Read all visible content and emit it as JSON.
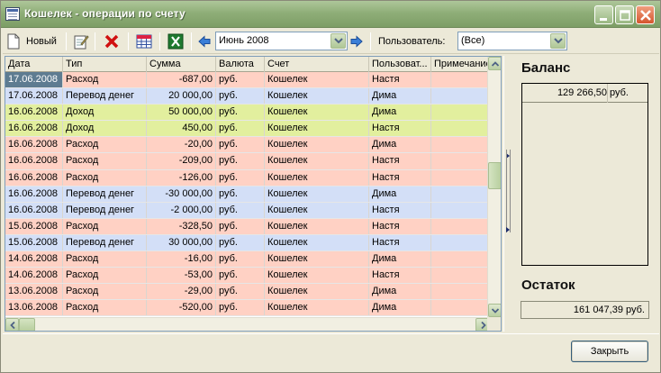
{
  "window": {
    "title": "Кошелек - операции по счету",
    "controls": [
      "minimize-icon",
      "maximize-icon",
      "close-icon"
    ]
  },
  "toolbar": {
    "new_label": "Новый",
    "period": "Июнь 2008",
    "user_label": "Пользователь:",
    "user_value": "(Все)",
    "icons": [
      "new-doc-icon",
      "edit-icon",
      "delete-icon",
      "table-icon",
      "excel-icon",
      "arrow-left-icon",
      "arrow-right-icon"
    ]
  },
  "grid": {
    "columns": [
      "Дата",
      "Тип",
      "Сумма",
      "Валюта",
      "Счет",
      "Пользоват...",
      "Примечание"
    ],
    "rows": [
      {
        "date": "17.06.2008",
        "type": "Расход",
        "amount": "-687,00",
        "currency": "руб.",
        "account": "Кошелек",
        "user": "Настя",
        "note": "",
        "kind": "out",
        "selected": true
      },
      {
        "date": "17.06.2008",
        "type": "Перевод денег",
        "amount": "20 000,00",
        "currency": "руб.",
        "account": "Кошелек",
        "user": "Дима",
        "note": "",
        "kind": "tr"
      },
      {
        "date": "16.06.2008",
        "type": "Доход",
        "amount": "50 000,00",
        "currency": "руб.",
        "account": "Кошелек",
        "user": "Дима",
        "note": "",
        "kind": "inc"
      },
      {
        "date": "16.06.2008",
        "type": "Доход",
        "amount": "450,00",
        "currency": "руб.",
        "account": "Кошелек",
        "user": "Настя",
        "note": "",
        "kind": "inc"
      },
      {
        "date": "16.06.2008",
        "type": "Расход",
        "amount": "-20,00",
        "currency": "руб.",
        "account": "Кошелек",
        "user": "Дима",
        "note": "",
        "kind": "out"
      },
      {
        "date": "16.06.2008",
        "type": "Расход",
        "amount": "-209,00",
        "currency": "руб.",
        "account": "Кошелек",
        "user": "Настя",
        "note": "",
        "kind": "out"
      },
      {
        "date": "16.06.2008",
        "type": "Расход",
        "amount": "-126,00",
        "currency": "руб.",
        "account": "Кошелек",
        "user": "Настя",
        "note": "",
        "kind": "out"
      },
      {
        "date": "16.06.2008",
        "type": "Перевод денег",
        "amount": "-30 000,00",
        "currency": "руб.",
        "account": "Кошелек",
        "user": "Дима",
        "note": "",
        "kind": "tr"
      },
      {
        "date": "16.06.2008",
        "type": "Перевод денег",
        "amount": "-2 000,00",
        "currency": "руб.",
        "account": "Кошелек",
        "user": "Настя",
        "note": "",
        "kind": "tr"
      },
      {
        "date": "15.06.2008",
        "type": "Расход",
        "amount": "-328,50",
        "currency": "руб.",
        "account": "Кошелек",
        "user": "Настя",
        "note": "",
        "kind": "out"
      },
      {
        "date": "15.06.2008",
        "type": "Перевод денег",
        "amount": "30 000,00",
        "currency": "руб.",
        "account": "Кошелек",
        "user": "Настя",
        "note": "",
        "kind": "tr"
      },
      {
        "date": "14.06.2008",
        "type": "Расход",
        "amount": "-16,00",
        "currency": "руб.",
        "account": "Кошелек",
        "user": "Дима",
        "note": "",
        "kind": "out"
      },
      {
        "date": "14.06.2008",
        "type": "Расход",
        "amount": "-53,00",
        "currency": "руб.",
        "account": "Кошелек",
        "user": "Настя",
        "note": "",
        "kind": "out"
      },
      {
        "date": "13.06.2008",
        "type": "Расход",
        "amount": "-29,00",
        "currency": "руб.",
        "account": "Кошелек",
        "user": "Дима",
        "note": "",
        "kind": "out"
      },
      {
        "date": "13.06.2008",
        "type": "Расход",
        "amount": "-520,00",
        "currency": "руб.",
        "account": "Кошелек",
        "user": "Дима",
        "note": "",
        "kind": "out"
      }
    ],
    "row_colors": {
      "out": "#ffd1c4",
      "tr": "#d3dff7",
      "inc": "#e2ef9e"
    }
  },
  "balance": {
    "title": "Баланс",
    "amount": "129 266,50",
    "currency": "руб."
  },
  "rest": {
    "title": "Остаток",
    "value": "161 047,39 руб."
  },
  "footer": {
    "close_label": "Закрыть"
  }
}
